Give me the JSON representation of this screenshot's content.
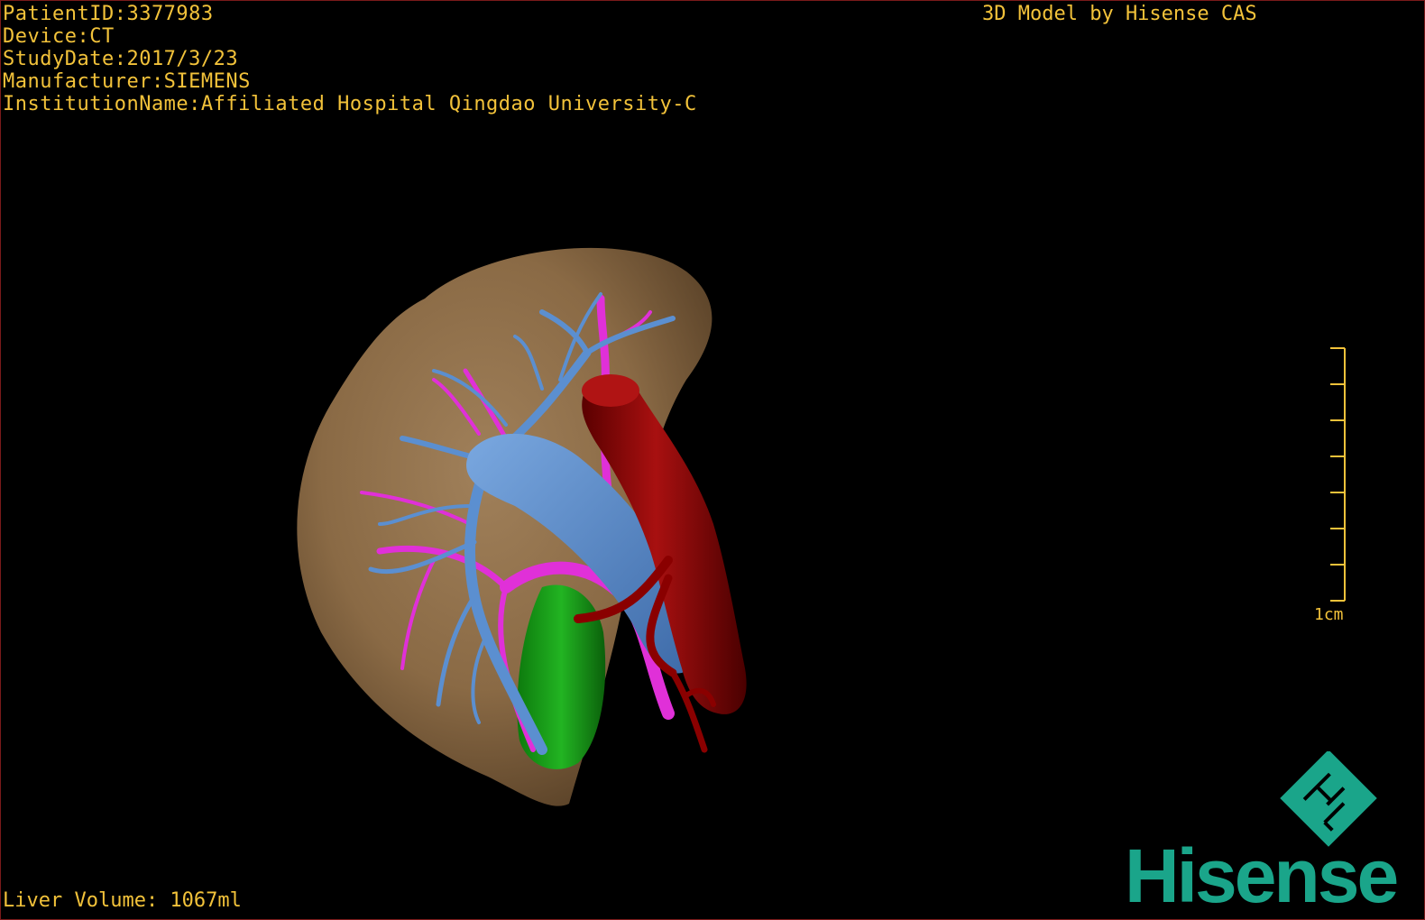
{
  "header": {
    "patient_id": "PatientID:3377983",
    "device": "Device:CT",
    "study_date": "StudyDate:2017/3/23",
    "manufacturer": "Manufacturer:SIEMENS",
    "institution": "InstitutionName:Affiliated Hospital Qingdao University-C"
  },
  "title": "3D Model by Hisense CAS",
  "footer": {
    "liver_volume": "Liver Volume: 1067ml"
  },
  "scale_bar": {
    "label": "1cm"
  },
  "brand": {
    "name": "Hisense",
    "logo_icon": "hisense-diamond-logo-icon"
  },
  "colors": {
    "overlay_text": "#f2c23a",
    "liver": "#8a6a45",
    "portal_vein": "#5b8fd0",
    "hepatic_vein": "#e030d8",
    "artery": "#8a0000",
    "gallbladder": "#1aa31a",
    "brand": "#1aa58a"
  }
}
